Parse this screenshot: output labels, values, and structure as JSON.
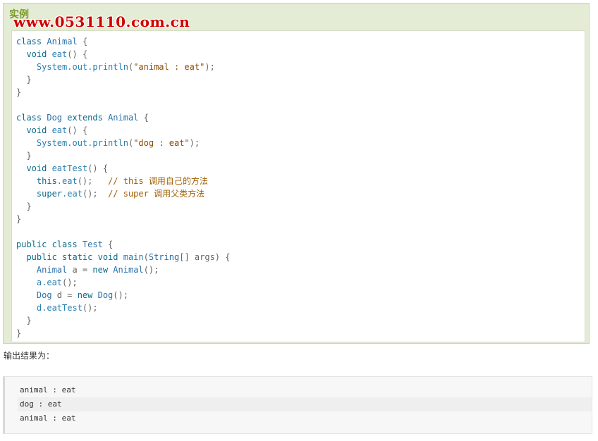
{
  "example": {
    "title": "实例",
    "watermark": "www.0531110.com.cn",
    "code_lines": [
      [
        {
          "t": "class ",
          "c": "kw"
        },
        {
          "t": "Animal",
          "c": "ty"
        },
        {
          "t": " {",
          "c": "pn"
        }
      ],
      [
        {
          "t": "  void ",
          "c": "kw"
        },
        {
          "t": "eat",
          "c": "mt"
        },
        {
          "t": "() {",
          "c": "pn"
        }
      ],
      [
        {
          "t": "    System.out.println",
          "c": "mt"
        },
        {
          "t": "(",
          "c": "pn"
        },
        {
          "t": "\"animal : eat\"",
          "c": "st"
        },
        {
          "t": ");",
          "c": "pn"
        }
      ],
      [
        {
          "t": "  }",
          "c": "pn"
        }
      ],
      [
        {
          "t": "}",
          "c": "pn"
        }
      ],
      [],
      [
        {
          "t": "class ",
          "c": "kw"
        },
        {
          "t": "Dog ",
          "c": "ty"
        },
        {
          "t": "extends ",
          "c": "kw"
        },
        {
          "t": "Animal",
          "c": "ty"
        },
        {
          "t": " {",
          "c": "pn"
        }
      ],
      [
        {
          "t": "  void ",
          "c": "kw"
        },
        {
          "t": "eat",
          "c": "mt"
        },
        {
          "t": "() {",
          "c": "pn"
        }
      ],
      [
        {
          "t": "    System.out.println",
          "c": "mt"
        },
        {
          "t": "(",
          "c": "pn"
        },
        {
          "t": "\"dog : eat\"",
          "c": "st"
        },
        {
          "t": ");",
          "c": "pn"
        }
      ],
      [
        {
          "t": "  }",
          "c": "pn"
        }
      ],
      [
        {
          "t": "  void ",
          "c": "kw"
        },
        {
          "t": "eatTest",
          "c": "mt"
        },
        {
          "t": "() {",
          "c": "pn"
        }
      ],
      [
        {
          "t": "    this",
          "c": "kw"
        },
        {
          "t": ".eat",
          "c": "mt"
        },
        {
          "t": "();   ",
          "c": "pn"
        },
        {
          "t": "// this ",
          "c": "cm"
        },
        {
          "t": "调用自己的方法",
          "c": "cm cn"
        }
      ],
      [
        {
          "t": "    super",
          "c": "kw"
        },
        {
          "t": ".eat",
          "c": "mt"
        },
        {
          "t": "();  ",
          "c": "pn"
        },
        {
          "t": "// super ",
          "c": "cm"
        },
        {
          "t": "调用父类方法",
          "c": "cm cn"
        }
      ],
      [
        {
          "t": "  }",
          "c": "pn"
        }
      ],
      [
        {
          "t": "}",
          "c": "pn"
        }
      ],
      [],
      [
        {
          "t": "public class ",
          "c": "kw"
        },
        {
          "t": "Test",
          "c": "ty"
        },
        {
          "t": " {",
          "c": "pn"
        }
      ],
      [
        {
          "t": "  public static void ",
          "c": "kw"
        },
        {
          "t": "main",
          "c": "mt"
        },
        {
          "t": "(",
          "c": "pn"
        },
        {
          "t": "String",
          "c": "ty"
        },
        {
          "t": "[] args) {",
          "c": "pn"
        }
      ],
      [
        {
          "t": "    Animal ",
          "c": "ty"
        },
        {
          "t": "a = ",
          "c": "pn"
        },
        {
          "t": "new ",
          "c": "kw"
        },
        {
          "t": "Animal",
          "c": "ty"
        },
        {
          "t": "();",
          "c": "pn"
        }
      ],
      [
        {
          "t": "    a.eat",
          "c": "mt"
        },
        {
          "t": "();",
          "c": "pn"
        }
      ],
      [
        {
          "t": "    Dog ",
          "c": "ty"
        },
        {
          "t": "d = ",
          "c": "pn"
        },
        {
          "t": "new ",
          "c": "kw"
        },
        {
          "t": "Dog",
          "c": "ty"
        },
        {
          "t": "();",
          "c": "pn"
        }
      ],
      [
        {
          "t": "    d.eatTest",
          "c": "mt"
        },
        {
          "t": "();",
          "c": "pn"
        }
      ],
      [
        {
          "t": "  }",
          "c": "pn"
        }
      ],
      [
        {
          "t": "}",
          "c": "pn"
        }
      ]
    ]
  },
  "output": {
    "label": "输出结果为：",
    "lines": [
      "animal : eat",
      "dog : eat",
      "animal : eat"
    ]
  }
}
